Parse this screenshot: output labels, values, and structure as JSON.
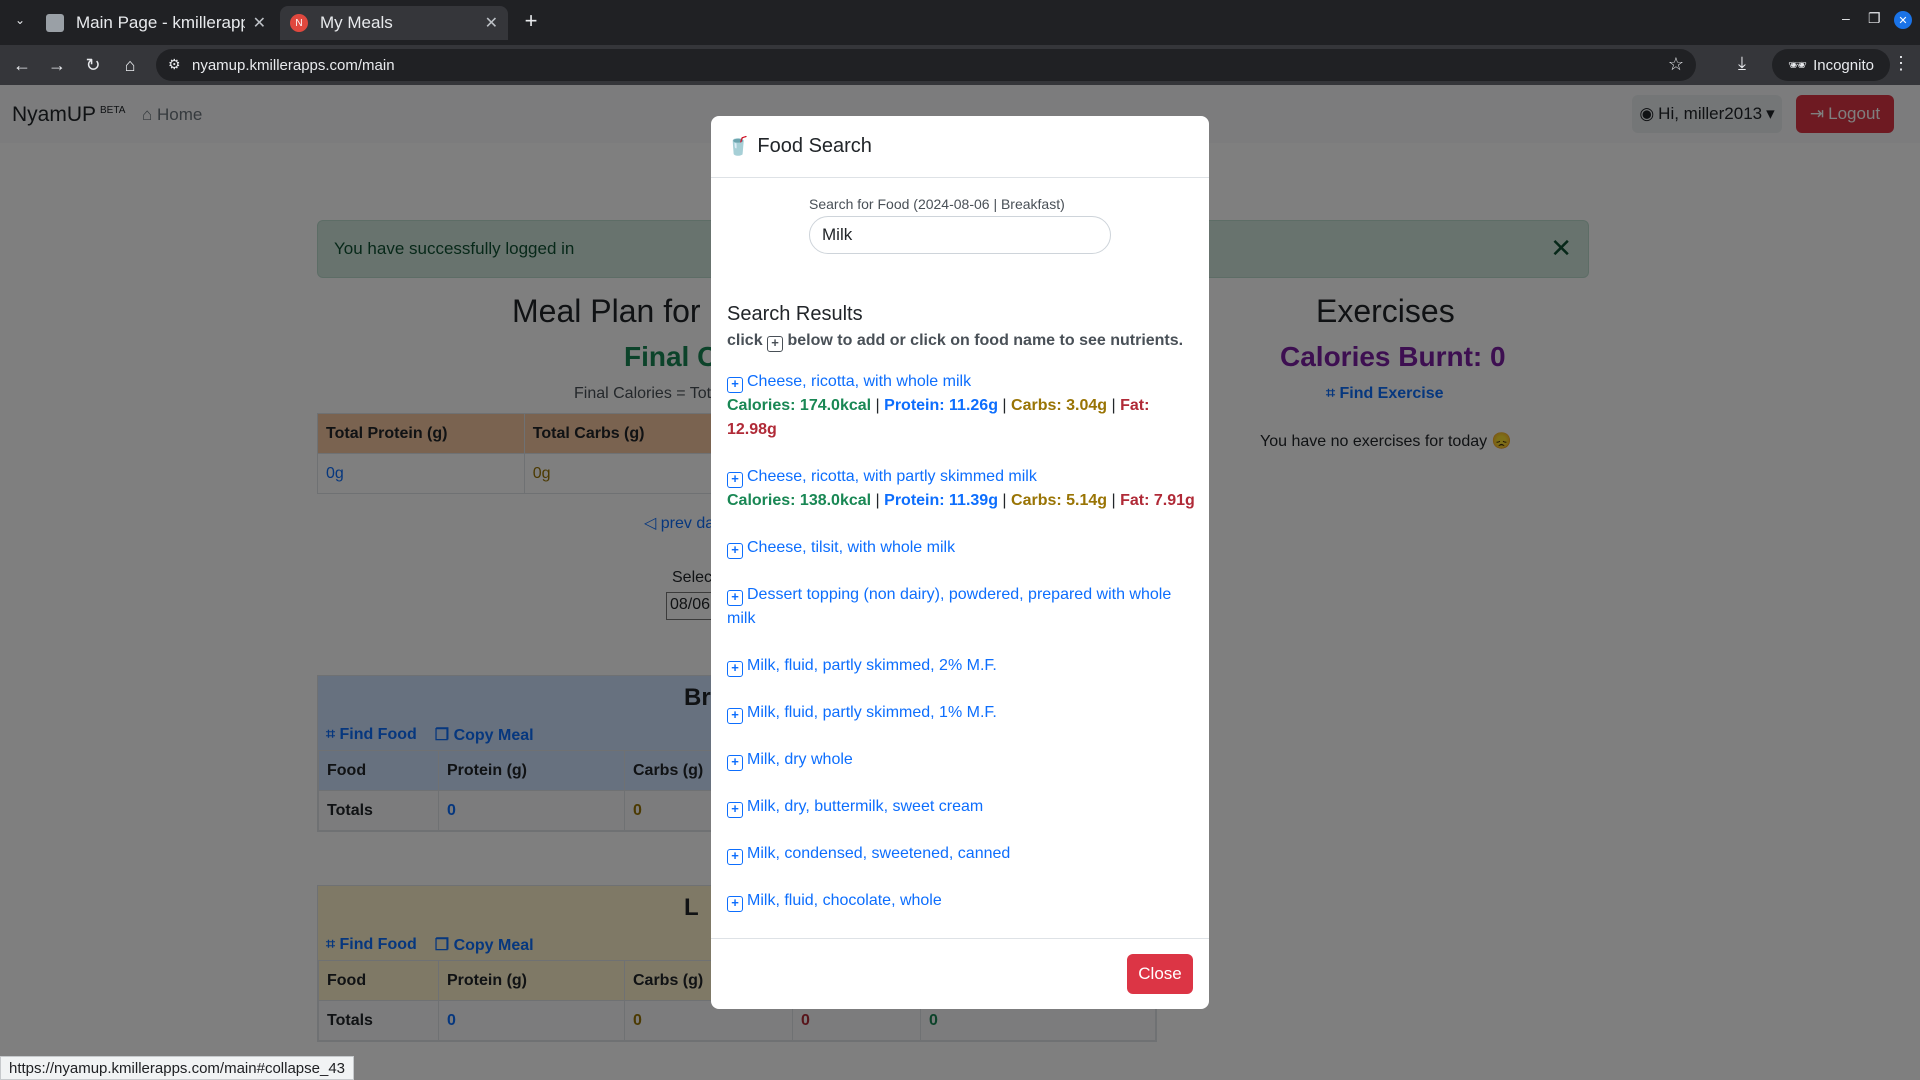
{
  "browser": {
    "tabs": [
      {
        "title": "Main Page - kmillerapps"
      },
      {
        "title": "My Meals"
      }
    ],
    "url": "nyamup.kmillerapps.com/main",
    "incognito_label": "Incognito",
    "status_url": "https://nyamup.kmillerapps.com/main#collapse_43"
  },
  "navbar": {
    "brand": "NyamUP",
    "brand_badge": "BETA",
    "home_label": "Home",
    "user_label": "Hi, miller2013",
    "logout_label": "Logout"
  },
  "alert": {
    "message": "You have successfully logged in"
  },
  "meal_plan": {
    "title_visible": "Meal Plan for",
    "final_calories_visible": "Final C",
    "formula_visible": "Final Calories = Tot",
    "totals_headers": [
      "Total Protein (g)",
      "Total Carbs (g)"
    ],
    "totals_values": [
      "0g",
      "0g"
    ],
    "prev_day_visible": "prev da",
    "select_visible": "Selec",
    "date_visible": "08/06"
  },
  "meals": [
    {
      "name_visible": "Br",
      "find_food": "Find Food",
      "copy_meal": "Copy Meal",
      "headers": [
        "Food",
        "Protein (g)",
        "Carbs (g)"
      ],
      "totals_label": "Totals",
      "totals": [
        "0",
        "0"
      ]
    },
    {
      "name_visible": "L",
      "find_food": "Find Food",
      "copy_meal": "Copy Meal",
      "headers": [
        "Food",
        "Protein (g)",
        "Carbs (g)"
      ],
      "totals_label": "Totals",
      "totals": [
        "0",
        "0",
        "0",
        "0"
      ]
    }
  ],
  "exercises": {
    "title": "Exercises",
    "calories_burnt": "Calories Burnt: 0",
    "find_exercise": "Find Exercise",
    "empty_message": "You have no exercises for today 😞"
  },
  "modal": {
    "title": "Food Search",
    "search_label": "Search for Food (2024-08-06 | Breakfast)",
    "search_value": "Milk",
    "results_title": "Search Results",
    "hint_before": "click",
    "hint_after": "below to add or click on food name to see nutrients.",
    "results": [
      {
        "name": "Cheese, ricotta, with whole milk",
        "calories": "Calories: 174.0kcal",
        "protein": "Protein: 11.26g",
        "carbs": "Carbs: 3.04g",
        "fat": "Fat: 12.98g"
      },
      {
        "name": "Cheese, ricotta, with partly skimmed milk",
        "calories": "Calories: 138.0kcal",
        "protein": "Protein: 11.39g",
        "carbs": "Carbs: 5.14g",
        "fat": "Fat: 7.91g"
      },
      {
        "name": "Cheese, tilsit, with whole milk"
      },
      {
        "name": "Dessert topping (non dairy), powdered, prepared with whole milk"
      },
      {
        "name": "Milk, fluid, partly skimmed, 2% M.F."
      },
      {
        "name": "Milk, fluid, partly skimmed, 1% M.F."
      },
      {
        "name": "Milk, dry whole"
      },
      {
        "name": "Milk, dry, buttermilk, sweet cream"
      },
      {
        "name": "Milk, condensed, sweetened, canned"
      },
      {
        "name": "Milk, fluid, chocolate, whole"
      }
    ],
    "close_label": "Close"
  },
  "colors": {
    "primary": "#0d6efd",
    "danger": "#dc3545",
    "success": "#198754",
    "carbs": "#997404",
    "fat": "#b02a37",
    "exercise": "#7b1fa2"
  }
}
